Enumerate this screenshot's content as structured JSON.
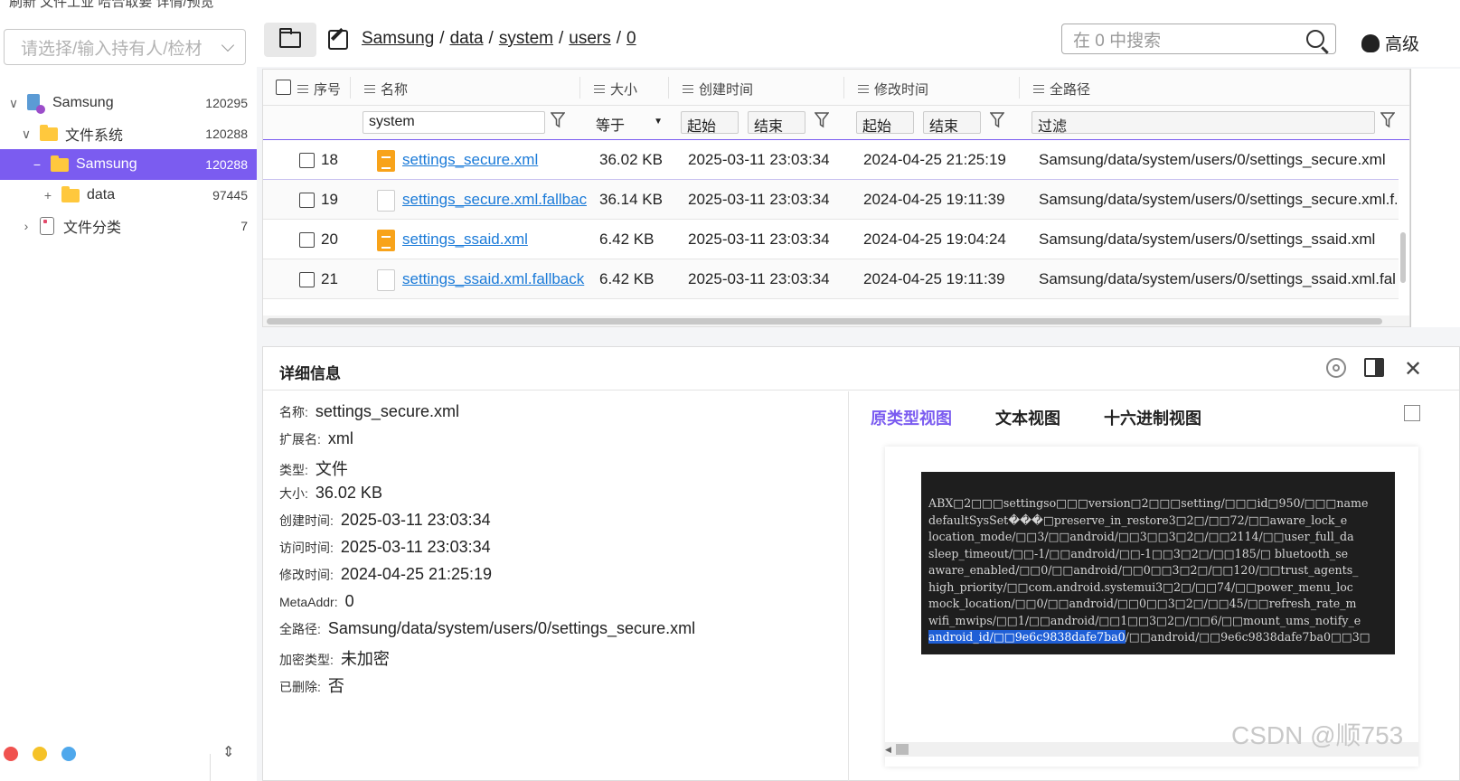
{
  "topstrip": {
    "text": "刷新     文件工业  哈合取要 详情/预览"
  },
  "sidebar": {
    "owner_placeholder": "请选择/输入持有人/检材",
    "tree": [
      {
        "label": "Samsung",
        "count": "120295"
      },
      {
        "label": "文件系统",
        "count": "120288"
      },
      {
        "label": "Samsung",
        "count": "120288"
      },
      {
        "label": "data",
        "count": "97445"
      },
      {
        "label": "文件分类",
        "count": "7"
      }
    ],
    "traffic_colors": [
      "#f0524f",
      "#f5c228",
      "#4fa8ec"
    ]
  },
  "toolbar": {
    "breadcrumb": [
      "Samsung",
      "data",
      "system",
      "users",
      "0"
    ],
    "search_placeholder": "在 0 中搜索",
    "advanced_label": "高级"
  },
  "table": {
    "columns": [
      "序号",
      "名称",
      "大小",
      "创建时间",
      "修改时间",
      "全路径"
    ],
    "filters": {
      "name": "system",
      "size_op": "等于",
      "start": "起始",
      "end": "结束",
      "path": "过滤"
    },
    "rows": [
      {
        "no": "18",
        "name": "settings_secure.xml",
        "size": "36.02 KB",
        "created": "2025-03-11 23:03:34",
        "modified": "2024-04-25 21:25:19",
        "path": "Samsung/data/system/users/0/settings_secure.xml",
        "icon": "xml-file-icon"
      },
      {
        "no": "19",
        "name": "settings_secure.xml.fallback",
        "size": "36.14 KB",
        "created": "2025-03-11 23:03:34",
        "modified": "2024-04-25 19:11:39",
        "path": "Samsung/data/system/users/0/settings_secure.xml.f...",
        "icon": "blank-file-icon"
      },
      {
        "no": "20",
        "name": "settings_ssaid.xml",
        "size": "6.42 KB",
        "created": "2025-03-11 23:03:34",
        "modified": "2024-04-25 19:04:24",
        "path": "Samsung/data/system/users/0/settings_ssaid.xml",
        "icon": "xml-file-icon"
      },
      {
        "no": "21",
        "name": "settings_ssaid.xml.fallback",
        "size": "6.42 KB",
        "created": "2025-03-11 23:03:34",
        "modified": "2024-04-25 19:11:39",
        "path": "Samsung/data/system/users/0/settings_ssaid.xml.fal...",
        "icon": "blank-file-icon"
      }
    ]
  },
  "detail": {
    "title": "详细信息",
    "props": [
      {
        "key": "名称:",
        "value": "settings_secure.xml"
      },
      {
        "key": "扩展名:",
        "value": "xml"
      },
      {
        "key": "类型:",
        "value": "文件"
      },
      {
        "key": "大小:",
        "value": "36.02 KB"
      },
      {
        "key": "创建时间:",
        "value": "2025-03-11 23:03:34"
      },
      {
        "key": "访问时间:",
        "value": "2025-03-11 23:03:34"
      },
      {
        "key": "修改时间:",
        "value": "2024-04-25 21:25:19"
      },
      {
        "key": "MetaAddr:",
        "value": "0"
      },
      {
        "key": "全路径:",
        "value": "Samsung/data/system/users/0/settings_secure.xml"
      },
      {
        "key": "加密类型:",
        "value": "未加密"
      },
      {
        "key": "已删除:",
        "value": "否"
      }
    ],
    "view_tabs": [
      "原类型视图",
      "文本视图",
      "十六进制视图"
    ],
    "preview_lines": [
      "ABX□2□□□settingso□□□version□2□□□setting/□□□id□950/□□□name",
      "defaultSysSet���□preserve_in_restore3□2□/□□72/□□aware_lock_e",
      "location_mode/□□3/□□android/□□3□□3□2□/□□2114/□□user_full_da",
      "sleep_timeout/□□-1/□□android/□□-1□□3□2□/□□185/□ bluetooth_se",
      "aware_enabled/□□0/□□android/□□0□□3□2□/□□120/□□trust_agents_",
      "high_priority/□□com.android.systemui3□2□/□□74/□□power_menu_loc",
      "mock_location/□□0/□□android/□□0□□3□2□/□□45/□□refresh_rate_m",
      "wifi_mwips/□□1/□□android/□□1□□3□2□/□□6/□□mount_ums_notify_e"
    ],
    "preview_last_highlight": "android_id/□□9e6c9838dafe7ba0",
    "preview_last_rest": "/□□android/□□9e6c9838dafe7ba0□□3□"
  },
  "watermark": "CSDN @顺753"
}
